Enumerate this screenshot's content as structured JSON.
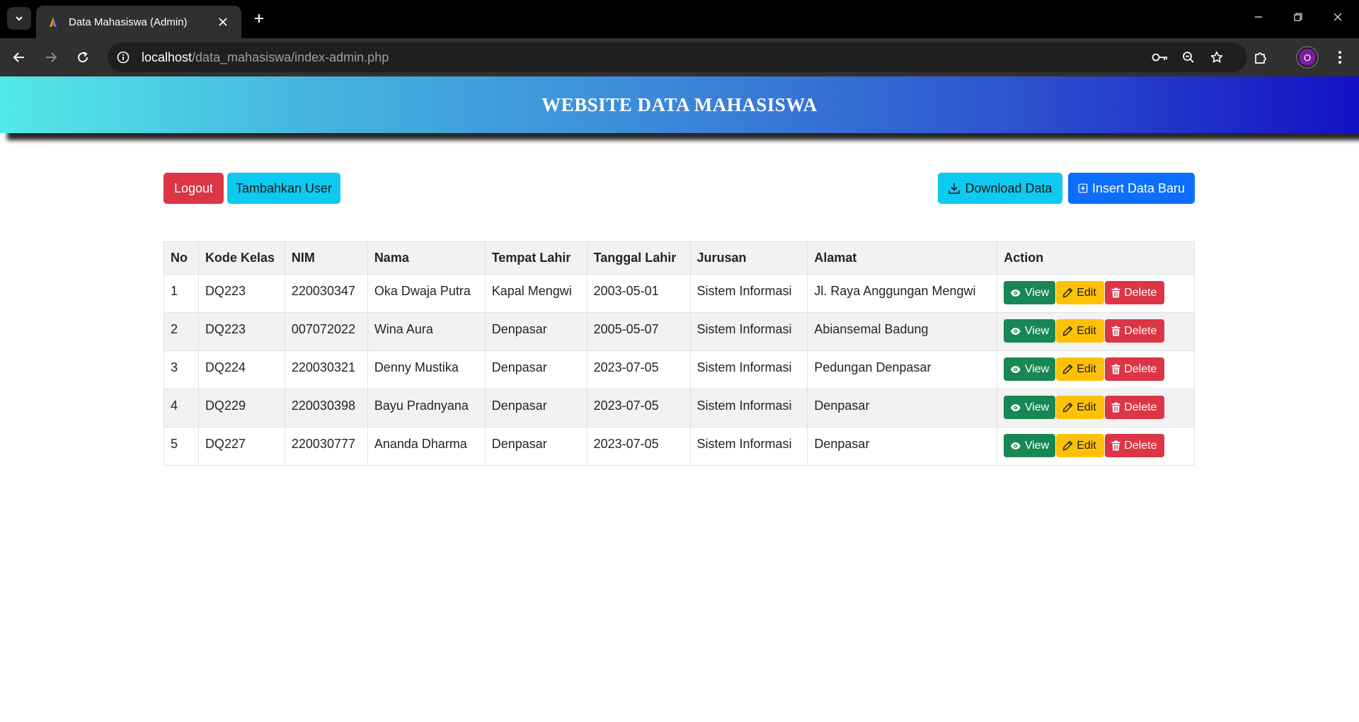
{
  "browser": {
    "tab_title": "Data Mahasiswa (Admin)",
    "url_host": "localhost",
    "url_path": "/data_mahasiswa/index-admin.php",
    "profile_initial": "O"
  },
  "header": {
    "title": "WEBSITE DATA MAHASISWA"
  },
  "actions": {
    "logout": "Logout",
    "add_user": "Tambahkan User",
    "download": "Download Data",
    "insert": "Insert Data Baru"
  },
  "table": {
    "headers": [
      "No",
      "Kode Kelas",
      "NIM",
      "Nama",
      "Tempat Lahir",
      "Tanggal Lahir",
      "Jurusan",
      "Alamat",
      "Action"
    ],
    "rows": [
      [
        "1",
        "DQ223",
        "220030347",
        "Oka Dwaja Putra",
        "Kapal Mengwi",
        "2003-05-01",
        "Sistem Informasi",
        "Jl. Raya Anggungan Mengwi"
      ],
      [
        "2",
        "DQ223",
        "007072022",
        "Wina Aura",
        "Denpasar",
        "2005-05-07",
        "Sistem Informasi",
        "Abiansemal Badung"
      ],
      [
        "3",
        "DQ224",
        "220030321",
        "Denny Mustika",
        "Denpasar",
        "2023-07-05",
        "Sistem Informasi",
        "Pedungan Denpasar"
      ],
      [
        "4",
        "DQ229",
        "220030398",
        "Bayu Pradnyana",
        "Denpasar",
        "2023-07-05",
        "Sistem Informasi",
        "Denpasar"
      ],
      [
        "5",
        "DQ227",
        "220030777",
        "Ananda Dharma",
        "Denpasar",
        "2023-07-05",
        "Sistem Informasi",
        "Denpasar"
      ]
    ],
    "row_actions": {
      "view": "View",
      "edit": "Edit",
      "delete": "Delete"
    }
  },
  "colors": {
    "danger": "#dc3545",
    "info": "#0dcaf0",
    "primary": "#0d6efd",
    "success": "#198754",
    "warning": "#ffc107"
  }
}
